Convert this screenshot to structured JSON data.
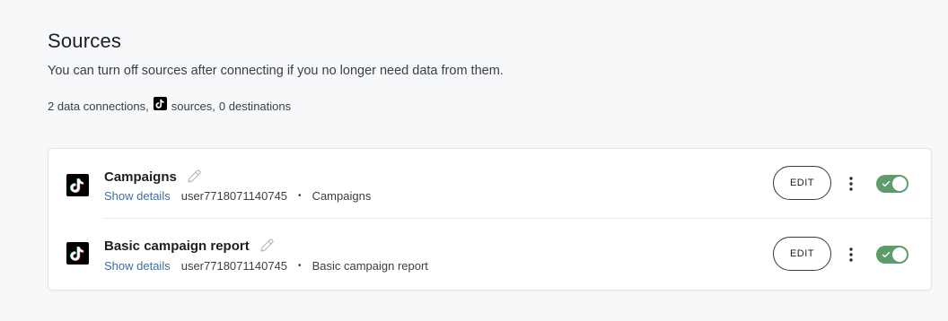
{
  "header": {
    "title": "Sources",
    "subtitle": "You can turn off sources after connecting if you no longer need data from them."
  },
  "summary": {
    "connections": "2 data connections,",
    "source_icon": "tiktok-icon",
    "sources": "sources,",
    "destinations": "0 destinations"
  },
  "sources": [
    {
      "name": "Campaigns",
      "icon": "tiktok-icon",
      "show_details": "Show details",
      "user": "user7718071140745",
      "separator": "•",
      "report": "Campaigns",
      "edit_label": "EDIT",
      "enabled": true
    },
    {
      "name": "Basic campaign report",
      "icon": "tiktok-icon",
      "show_details": "Show details",
      "user": "user7718071140745",
      "separator": "•",
      "report": "Basic campaign report",
      "edit_label": "EDIT",
      "enabled": true
    }
  ],
  "colors": {
    "toggle_on": "#5c9c6a",
    "link": "#3b6fa3",
    "button_border": "#2b3b4c"
  }
}
